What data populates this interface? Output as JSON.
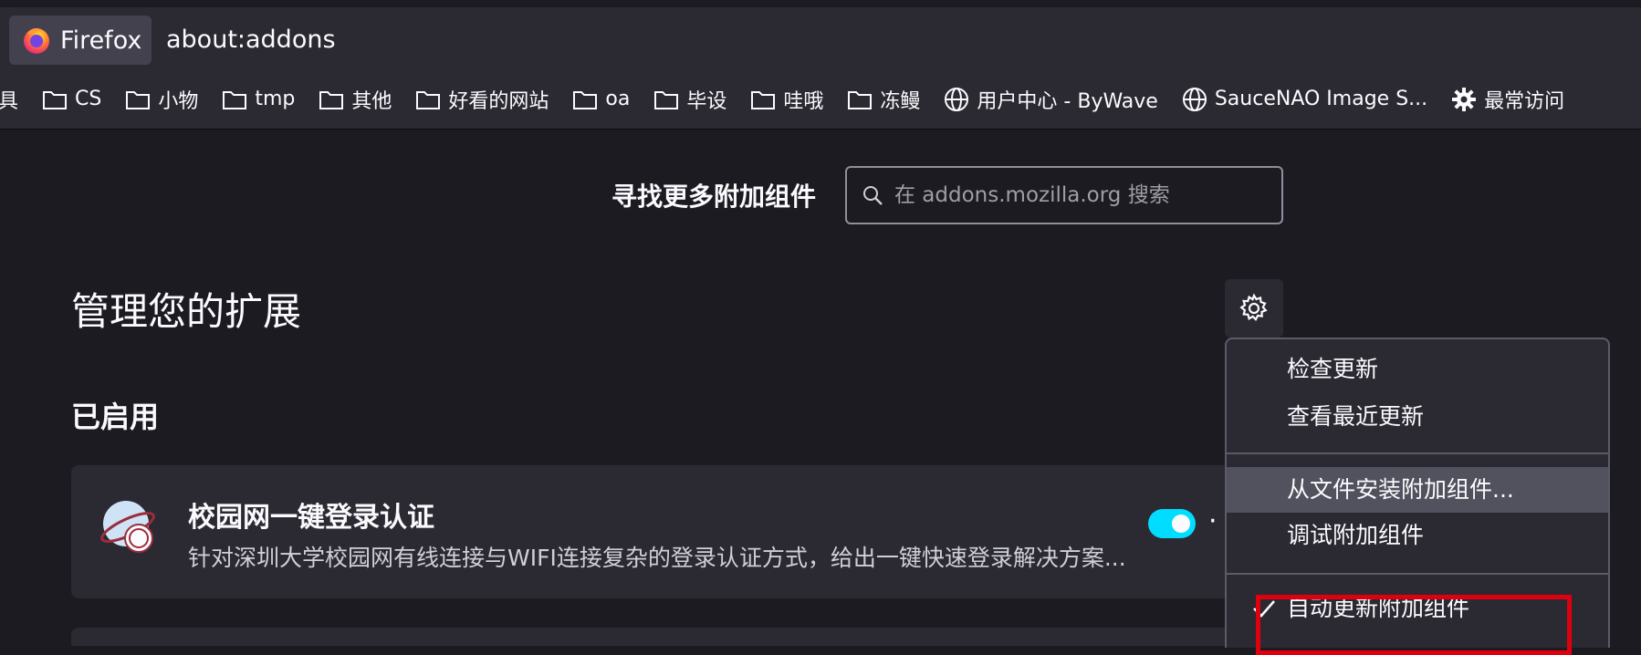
{
  "browser": {
    "identity_label": "Firefox",
    "url": "about:addons"
  },
  "bookmarks": {
    "cut_label": "具",
    "items": [
      {
        "label": "CS",
        "icon": "folder-icon"
      },
      {
        "label": "小物",
        "icon": "folder-icon"
      },
      {
        "label": "tmp",
        "icon": "folder-icon"
      },
      {
        "label": "其他",
        "icon": "folder-icon"
      },
      {
        "label": "好看的网站",
        "icon": "folder-icon"
      },
      {
        "label": "oa",
        "icon": "folder-icon"
      },
      {
        "label": "毕设",
        "icon": "folder-icon"
      },
      {
        "label": "哇哦",
        "icon": "folder-icon"
      },
      {
        "label": "冻鳗",
        "icon": "folder-icon"
      },
      {
        "label": "用户中心 - ByWave",
        "icon": "globe-icon"
      },
      {
        "label": "SauceNAO Image S...",
        "icon": "globe-icon"
      },
      {
        "label": "最常访问",
        "icon": "gear-icon"
      }
    ]
  },
  "header": {
    "find_more_label": "寻找更多附加组件",
    "search_placeholder": "在 addons.mozilla.org 搜索"
  },
  "main": {
    "page_title": "管理您的扩展",
    "enabled_section_title": "已启用",
    "addon": {
      "name": "校园网一键登录认证",
      "description": "针对深圳大学校园网有线连接与WIFI连接复杂的登录认证方式，给出一键快速登录解决方案...",
      "enabled": true,
      "more_label": "·"
    }
  },
  "menu": {
    "items": [
      {
        "label": "检查更新"
      },
      {
        "label": "查看最近更新"
      },
      {
        "label": "从文件安装附加组件..."
      },
      {
        "label": "调试附加组件"
      },
      {
        "label": "自动更新附加组件",
        "checked": true
      }
    ]
  },
  "colors": {
    "background": "#1c1b22",
    "toolbar": "#2b2a33",
    "accent_toggle": "#00ddff",
    "highlight_box": "#e0000d"
  }
}
